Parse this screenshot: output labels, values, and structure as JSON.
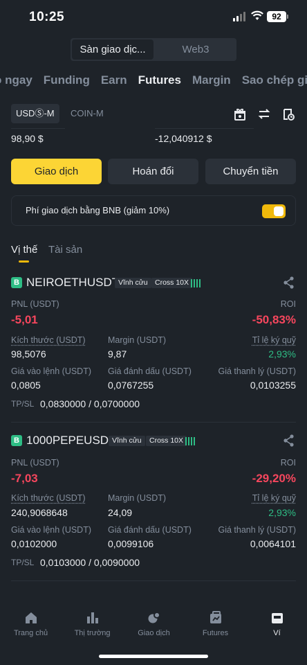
{
  "status_bar": {
    "time": "10:25",
    "battery": "92"
  },
  "segment": {
    "items": [
      "Sàn giao dịc...",
      "Web3"
    ],
    "selected": "Sàn giao dịc..."
  },
  "top_tabs": [
    "o ngay",
    "Funding",
    "Earn",
    "Futures",
    "Margin",
    "Sao chép giao"
  ],
  "top_tabs_active": "Futures",
  "sub_tabs": {
    "usds_m": "USDⓈ-M",
    "coin_m": "COIN-M"
  },
  "toolbar_icons": [
    "gift-icon",
    "transfer-icon",
    "history-icon"
  ],
  "balances": {
    "left": "98,90 $",
    "right": "-12,040912 $"
  },
  "actions": {
    "trade": "Giao dịch",
    "convert": "Hoán đổi",
    "transfer": "Chuyển tiền"
  },
  "bnb_fee": {
    "label": "Phí giao dịch bằng BNB (giảm 10%)",
    "enabled": true
  },
  "position_tabs": {
    "positions": "Vị thế",
    "assets": "Tài sản",
    "active": "Vị thế"
  },
  "labels": {
    "pnl": "PNL (USDT)",
    "roi": "ROI",
    "size": "Kích thước (USDT)",
    "margin": "Margin (USDT)",
    "margin_ratio": "Tỉ lệ ký quỹ",
    "entry": "Giá vào lệnh (USDT)",
    "mark": "Giá đánh dấu (USDT)",
    "liq": "Giá thanh lý (USDT)",
    "tpsl": "TP/SL"
  },
  "positions": [
    {
      "badge": "B",
      "symbol": "NEIROETHUSDT",
      "type": "Vĩnh cửu",
      "mode": "Cross 10X",
      "pnl": "-5,01",
      "roi": "-50,83%",
      "size": "98,5076",
      "margin": "9,87",
      "margin_ratio": "2,93%",
      "entry": "0,0805",
      "mark": "0,0767255",
      "liq": "0,0103255",
      "tpsl": "0,0830000 / 0,0700000"
    },
    {
      "badge": "B",
      "symbol": "1000PEPEUSDT",
      "type": "Vĩnh cửu",
      "mode": "Cross 10X",
      "pnl": "-7,03",
      "roi": "-29,20%",
      "size": "240,9068648",
      "margin": "24,09",
      "margin_ratio": "2,93%",
      "entry": "0,0102000",
      "mark": "0,0099106",
      "liq": "0,0064101",
      "tpsl": "0,0103000 / 0,0090000"
    }
  ],
  "bottom_nav": [
    {
      "label": "Trang chủ",
      "icon": "home-icon"
    },
    {
      "label": "Thị trường",
      "icon": "markets-icon"
    },
    {
      "label": "Giao dịch",
      "icon": "trade-icon"
    },
    {
      "label": "Futures",
      "icon": "futures-icon"
    },
    {
      "label": "Ví",
      "icon": "wallet-icon",
      "active": true
    }
  ],
  "colors": {
    "accent": "#fcd535",
    "loss": "#f6465d",
    "gain": "#2ebd85",
    "bg": "#1e2329",
    "muted": "#848e9c"
  }
}
